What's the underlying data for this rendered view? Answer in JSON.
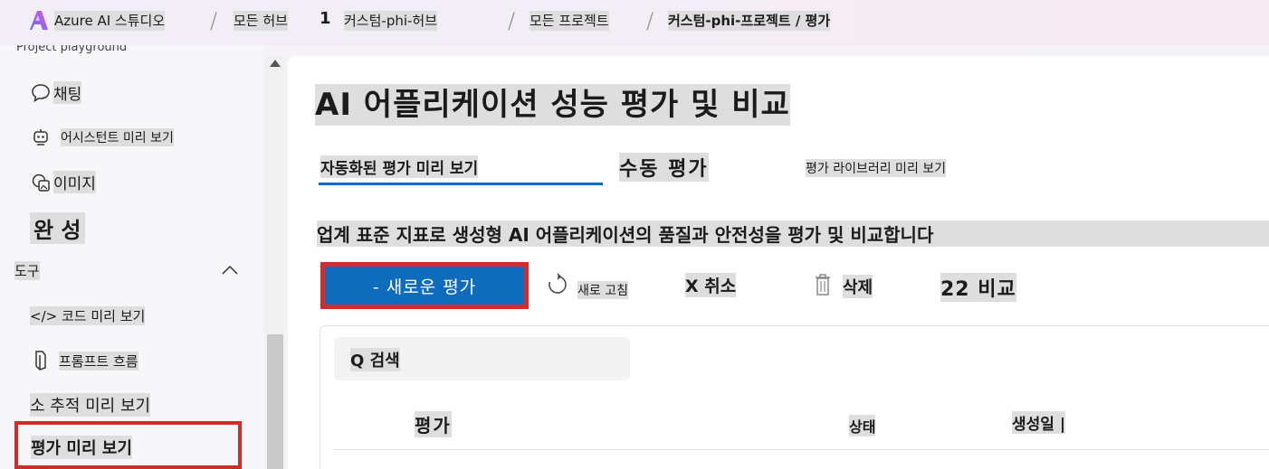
{
  "header": {
    "app_name": "Azure AI 스튜디오",
    "crumbs": [
      "모든 허브",
      "1",
      "커스텀-phi-허브",
      "모든 프로젝트",
      "커스텀-phi-프로젝트 / 평가"
    ],
    "logo_icon": "azure-ai-logo-icon",
    "brand_colors": [
      "#5c6cf5",
      "#e25ad3"
    ]
  },
  "sidebar": {
    "cut_label": "Project playground",
    "items": [
      {
        "label": "채팅",
        "icon": "chat-icon"
      },
      {
        "label": "어시스턴트 미리 보기",
        "icon": "bot-icon"
      },
      {
        "label": "이미지",
        "icon": "image-icon"
      },
      {
        "label": "완 성"
      }
    ],
    "tools_section": {
      "label": "도구",
      "icon": "chevron-up-icon",
      "items": [
        {
          "label": "</> 코드 미리 보기"
        },
        {
          "label": "프롬프트 흐름",
          "icon": "flow-icon"
        },
        {
          "label": "소 추적 미리 보기"
        },
        {
          "label": "평가 미리 보기"
        }
      ]
    }
  },
  "main": {
    "title": "AI 어플리케이션 성능 평가 및 비교",
    "tabs": [
      "자동화된 평가 미리 보기",
      "수동 평가",
      "평가 라이브러리 미리 보기"
    ],
    "active_tab": 0,
    "description": "업계 표준 지표로 생성형 AI 어플리케이션의 품질과 안전성을 평가 및 비교합니다",
    "toolbar": {
      "new_label": "- 새로운 평가",
      "refresh_label": "새로 고침",
      "refresh_icon": "refresh-icon",
      "cancel_label": "X 취소",
      "delete_label": "삭제",
      "delete_icon": "trash-icon",
      "compare_label": "22 비교"
    },
    "search_label": "Q 검색",
    "columns": [
      "평가",
      "상태",
      "생성일 |"
    ]
  },
  "colors": {
    "accent": "#0f6cbd",
    "highlight_red": "#d42a2a"
  }
}
